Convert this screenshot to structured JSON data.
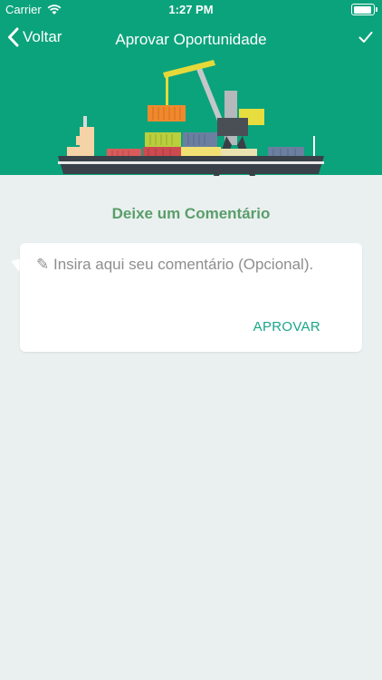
{
  "status_bar": {
    "carrier": "Carrier",
    "time": "1:27 PM"
  },
  "nav": {
    "back_label": "Voltar",
    "title": "Aprovar Oportunidade"
  },
  "comment": {
    "section_title": "Deixe um Comentário",
    "placeholder": "✎ Insira aqui seu comentário (Opcional).",
    "value": "",
    "approve_label": "APROVAR"
  },
  "colors": {
    "header_green": "#0ba37c",
    "background": "#eaf0ef",
    "title_green": "#5a9e6b",
    "accent": "#1aa58a"
  },
  "icons": [
    "wifi-icon",
    "battery-icon",
    "chevron-left-icon",
    "checkmark-icon",
    "cargo-ship-illustration"
  ]
}
